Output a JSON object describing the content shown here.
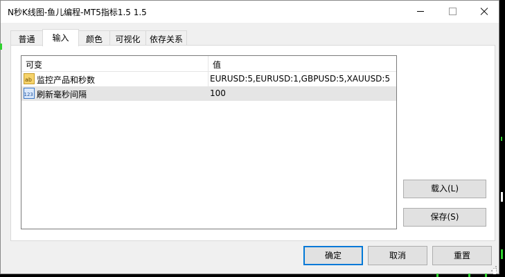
{
  "window": {
    "title": "N秒K线图-鱼儿编程-MT5指标1.5 1.5"
  },
  "tabs": [
    {
      "label": "普通",
      "active": false
    },
    {
      "label": "输入",
      "active": true
    },
    {
      "label": "颜色",
      "active": false
    },
    {
      "label": "可视化",
      "active": false
    },
    {
      "label": "依存关系",
      "active": false
    }
  ],
  "inputs": {
    "columns": {
      "variable": "可变",
      "value": "值"
    },
    "rows": [
      {
        "icon": "string-ab-icon",
        "name": "监控产品和秒数",
        "value": "EURUSD:5,EURUSD:1,GBPUSD:5,XAUUSD:5",
        "selected": false
      },
      {
        "icon": "integer-123-icon",
        "name": "刷新毫秒间隔",
        "value": "100",
        "selected": true
      }
    ]
  },
  "side_buttons": {
    "load": "载入(L)",
    "save": "保存(S)"
  },
  "footer": {
    "ok": "确定",
    "cancel": "取消",
    "reset": "重置"
  },
  "colors": {
    "accent": "#0078d7",
    "chart_bg": "#000000",
    "chart_candle": "#2fd12f"
  }
}
